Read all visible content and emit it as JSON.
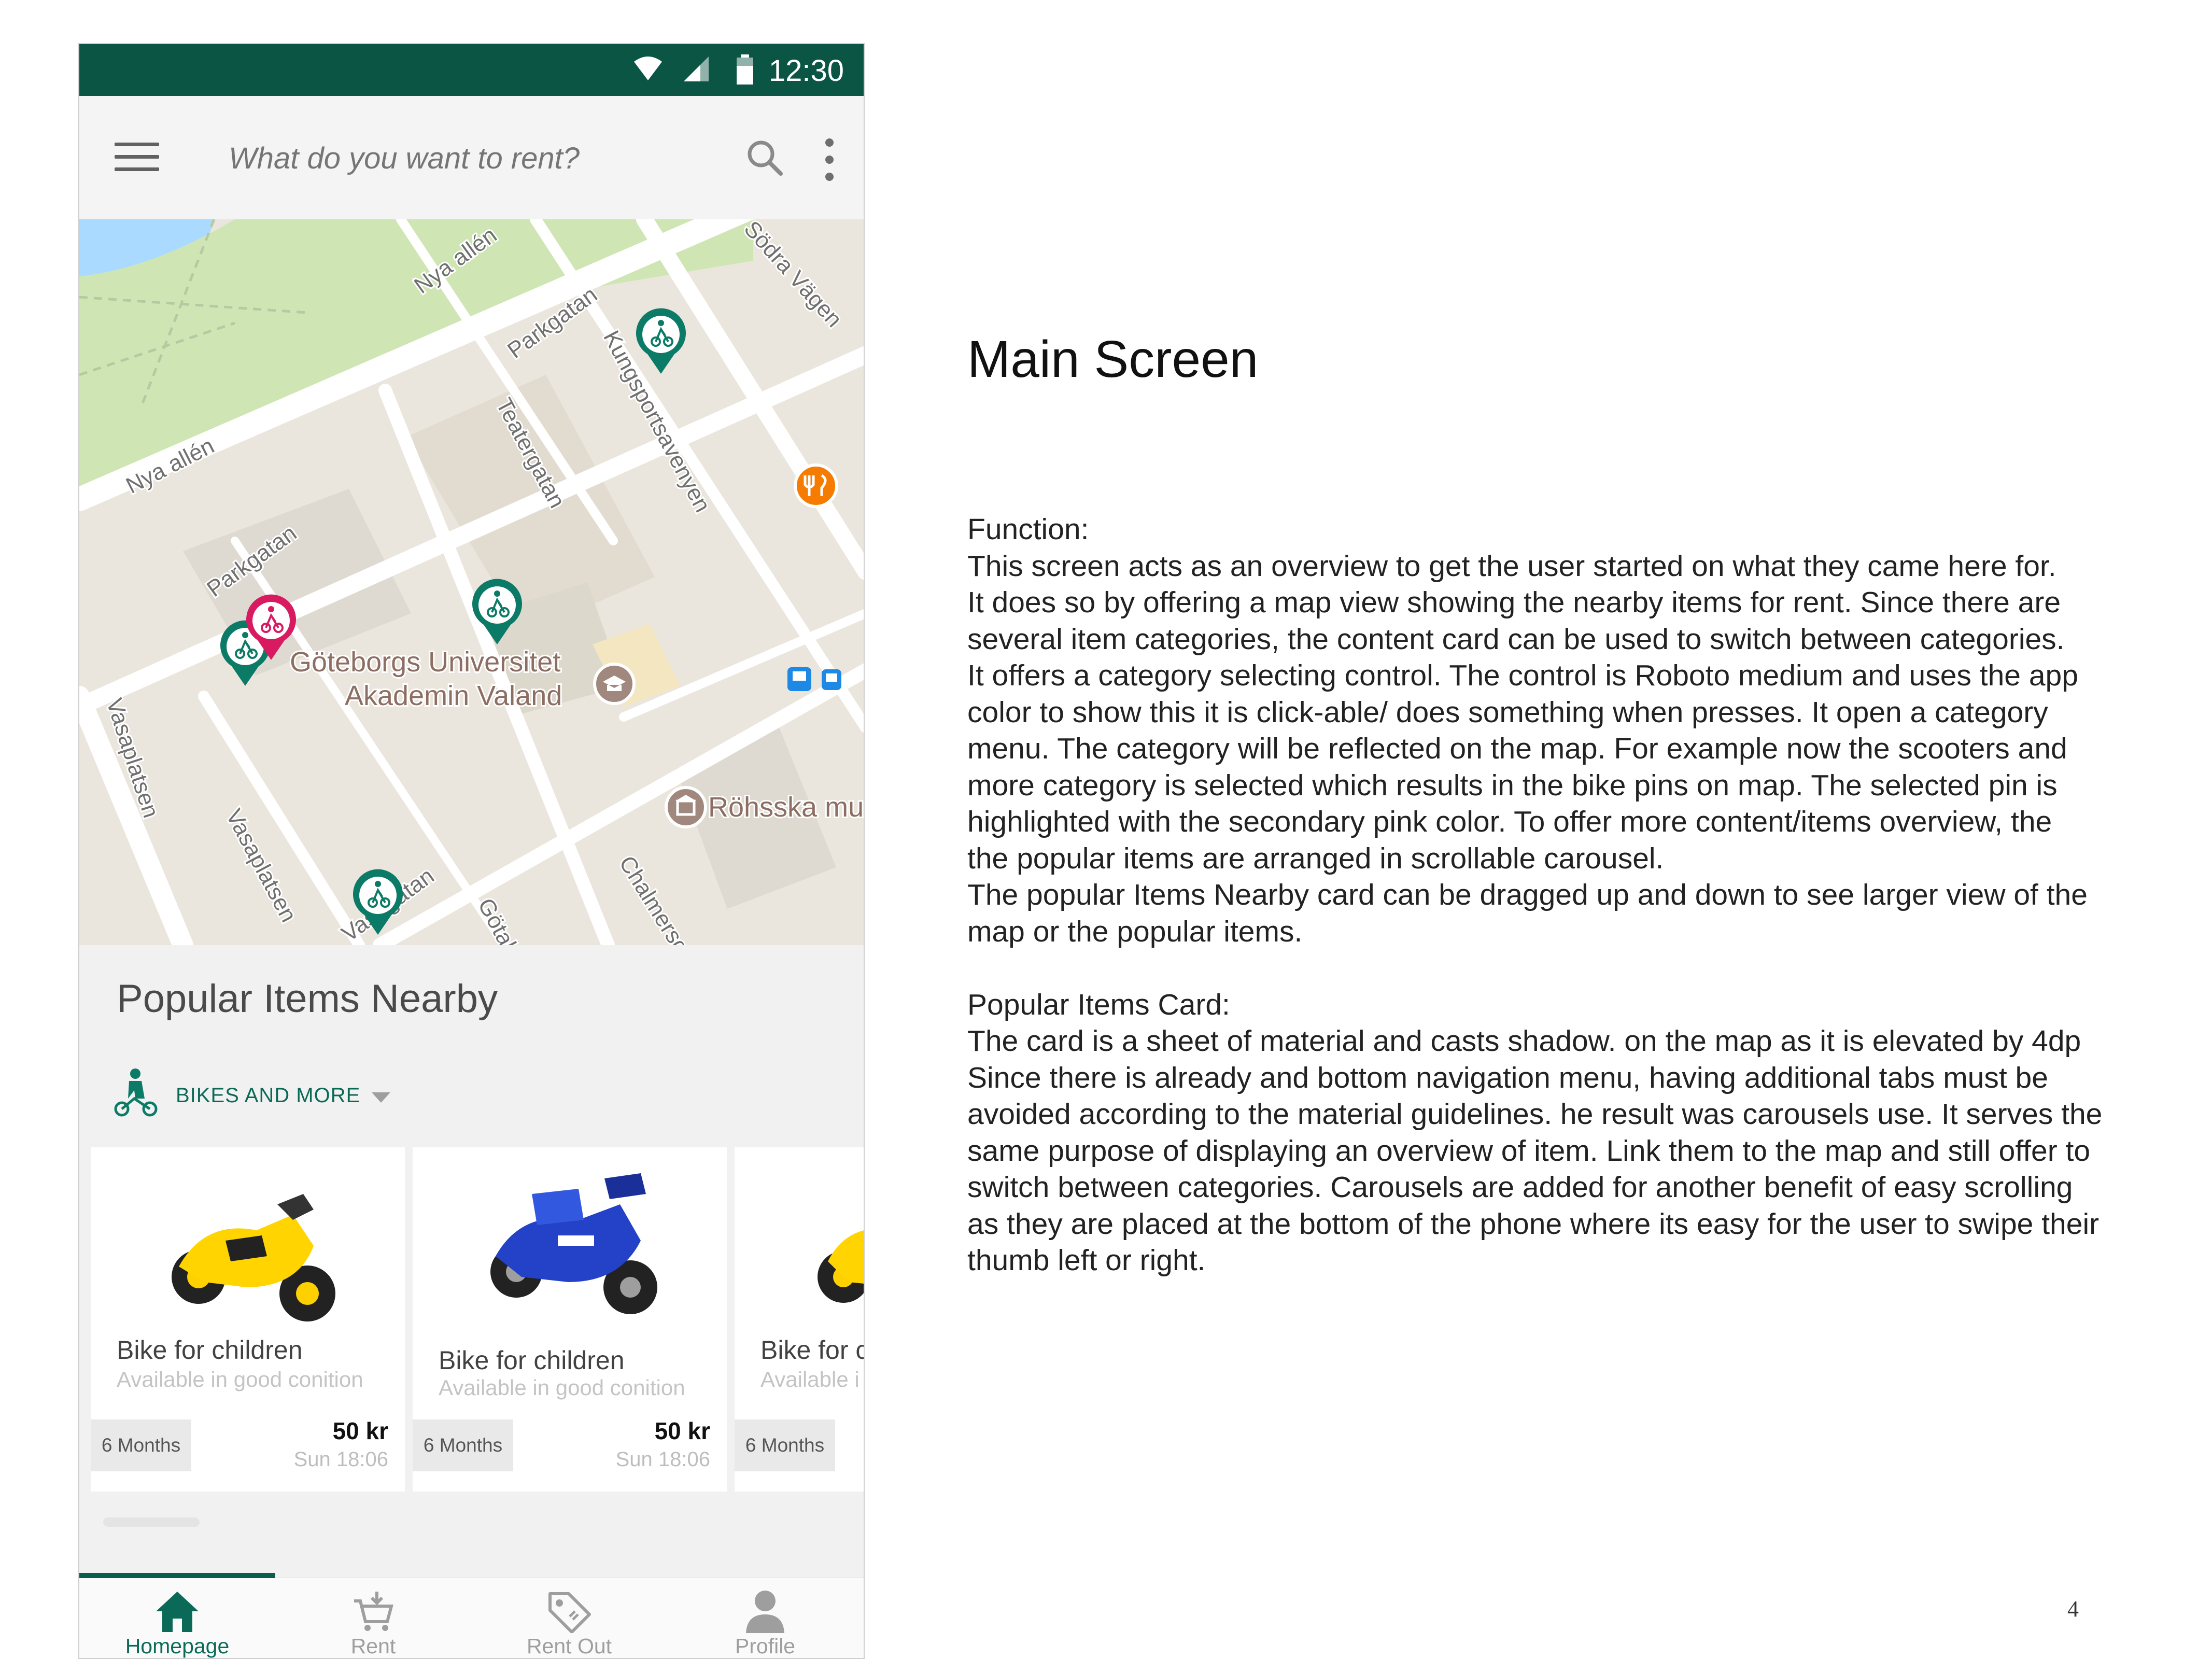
{
  "status_bar": {
    "time": "12:30"
  },
  "app_bar": {
    "search_placeholder": "What do you want to rent?"
  },
  "map": {
    "street_labels": [
      "Nya allén",
      "Nya allén",
      "Parkgatan",
      "Parkgatan",
      "Södra Vägen",
      "Kungsportsavenyen",
      "Teatergatan",
      "Vasaplatsen",
      "Vasaplatsen",
      "Vasagatan",
      "Götabe",
      "Chalmersgata"
    ],
    "poi_labels": [
      "Göteborgs Universitet",
      "Akademin Valand",
      "Röhsska mu"
    ]
  },
  "sheet": {
    "title": "Popular Items Nearby",
    "category_label": "BIKES AND MORE",
    "cards": [
      {
        "title": "Bike for children",
        "subtitle": "Available in good conition",
        "duration": "6 Months",
        "price": "50 kr",
        "time": "Sun 18:06"
      },
      {
        "title": "Bike for children",
        "subtitle": "Available in good conition",
        "duration": "6 Months",
        "price": "50 kr",
        "time": "Sun 18:06"
      },
      {
        "title": "Bike for c",
        "subtitle": "Available i",
        "duration": "6 Months",
        "price": "",
        "time": ""
      }
    ]
  },
  "bottom_nav": [
    {
      "label": "Homepage",
      "active": true
    },
    {
      "label": "Rent",
      "active": false
    },
    {
      "label": "Rent Out",
      "active": false
    },
    {
      "label": "Profile",
      "active": false
    }
  ],
  "document": {
    "title": "Main Screen",
    "function_heading": "Function:",
    "function_lines": [
      "This screen acts as an overview to get the user started on what they came here for.",
      "It does so by offering a map view showing the nearby items for rent. Since there are",
      "several item categories, the content card can be used to switch between categories.",
      "It offers a category selecting control. The control is Roboto medium and uses the app",
      "color to show this it is click-able/ does something when presses. It open a category",
      "menu. The category will be reflected on the map. For example now the scooters and",
      "more category is selected which results in the bike pins on map. The selected pin is",
      "highlighted with the secondary pink color. To offer more content/items overview, the",
      "the popular items are arranged in scrollable carousel.",
      "The popular Items Nearby card can be dragged up and down to see larger view  of the",
      "map or the popular items."
    ],
    "card_heading": "Popular Items Card:",
    "card_lines": [
      "The card is a sheet of material and casts shadow. on the map as it is elevated by 4dp",
      "Since there is already and bottom navigation menu, having additional tabs must be",
      "avoided according to the material guidelines.  he result was carousels use. It serves the",
      "same purpose of displaying an overview of item. Link them to the map and still offer to",
      "switch between categories. Carousels are added for another benefit of easy scrolling",
      "as they are placed at the bottom of the phone where its easy for the user to swipe their",
      "thumb left or right."
    ],
    "page_number": "4"
  },
  "colors": {
    "primary": "#0b5544",
    "accent_pink": "#d81b60",
    "pin_green": "#0b7a66",
    "map_bg": "#ebe6dd",
    "park": "#cfe6b4",
    "water": "#aadaff"
  }
}
